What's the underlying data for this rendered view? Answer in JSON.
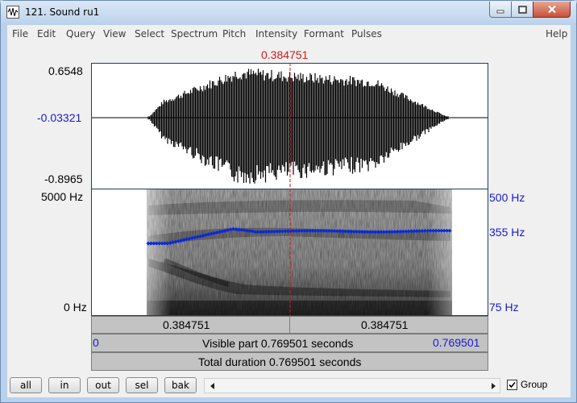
{
  "window": {
    "title": "121. Sound ru1"
  },
  "menu": [
    "File",
    "Edit",
    "Query",
    "View",
    "Select",
    "Spectrum",
    "Pitch",
    "Intensity",
    "Formant",
    "Pulses"
  ],
  "menu_help": "Help",
  "cursor": {
    "time_label": "0.384751"
  },
  "waveform": {
    "max_label": "0.6548",
    "mid_label": "-0.03321",
    "min_label": "-0.8965"
  },
  "spectrogram": {
    "top_label": "5000 Hz",
    "bottom_label": "0 Hz"
  },
  "pitch": {
    "top_label": "500 Hz",
    "mid_label": "355 Hz",
    "bottom_label": "75 Hz"
  },
  "selection": {
    "left_label": "0.384751",
    "right_label": "0.384751"
  },
  "visible": {
    "start": "0",
    "text": "Visible part 0.769501 seconds",
    "end": "0.769501"
  },
  "total": {
    "text": "Total duration 0.769501 seconds"
  },
  "buttons": {
    "all": "all",
    "in": "in",
    "out": "out",
    "sel": "sel",
    "bak": "bak"
  },
  "group": {
    "label": "Group",
    "checked": true
  },
  "colors": {
    "cursor": "#d11a1a",
    "axis_blue": "#1a1ad1",
    "pitch": "#0a28dc"
  }
}
